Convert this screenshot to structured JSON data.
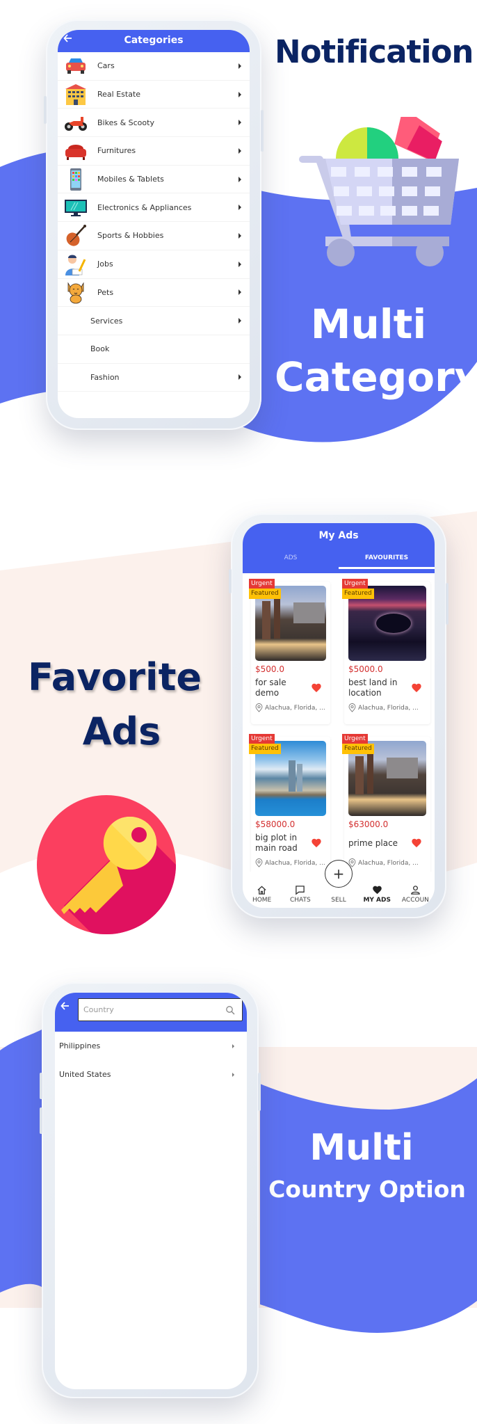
{
  "colors": {
    "brand_blue": "#4661f0",
    "wave_blue": "#5d72f2",
    "navy_text": "#0b2463",
    "peach_bg": "#fcf1ec",
    "price_red": "#d32f2f",
    "urgent_red": "#e53935",
    "featured_yellow": "#ffc107",
    "heart_red": "#f44336"
  },
  "section1": {
    "headline": "Notification",
    "feature_line1": "Multi",
    "feature_line2": "Category",
    "illustration": "shopping-cart-icon",
    "screen": {
      "title": "Categories",
      "back_icon": "arrow-left-icon",
      "categories": [
        {
          "label": "Cars",
          "icon": "car-icon",
          "has_children": true
        },
        {
          "label": "Real Estate",
          "icon": "building-icon",
          "has_children": true
        },
        {
          "label": "Bikes & Scooty",
          "icon": "motorcycle-icon",
          "has_children": true
        },
        {
          "label": "Furnitures",
          "icon": "sofa-icon",
          "has_children": true
        },
        {
          "label": "Mobiles & Tablets",
          "icon": "smartphone-icon",
          "has_children": true
        },
        {
          "label": "Electronics & Appliances",
          "icon": "tv-icon",
          "has_children": true
        },
        {
          "label": "Sports & Hobbies",
          "icon": "violin-icon",
          "has_children": true
        },
        {
          "label": "Jobs",
          "icon": "worker-icon",
          "has_children": true
        },
        {
          "label": "Pets",
          "icon": "cat-icon",
          "has_children": true
        },
        {
          "label": "Services",
          "icon": null,
          "has_children": true
        },
        {
          "label": "Book",
          "icon": null,
          "has_children": false
        },
        {
          "label": "Fashion",
          "icon": null,
          "has_children": true
        }
      ]
    }
  },
  "section2": {
    "feature_line1": "Favorite",
    "feature_line2": "Ads",
    "illustration": "key-icon",
    "screen": {
      "title": "My Ads",
      "tabs": [
        {
          "label": "ADS",
          "active": false
        },
        {
          "label": "FAVOURITES",
          "active": true
        }
      ],
      "ads": [
        {
          "price": "$500.0",
          "title": "for sale demo",
          "location": "Alachua, Florida, ...",
          "badges": [
            "Urgent",
            "Featured"
          ],
          "favorited": true,
          "image": "city-dusk-photo"
        },
        {
          "price": "$5000.0",
          "title": "best land in location",
          "location": "Alachua, Florida, ...",
          "badges": [
            "Urgent",
            "Featured"
          ],
          "favorited": true,
          "image": "night-bay-photo"
        },
        {
          "price": "$58000.0",
          "title": "big plot in main road",
          "location": "Alachua, Florida, ...",
          "badges": [
            "Urgent",
            "Featured"
          ],
          "favorited": true,
          "image": "coastal-city-photo"
        },
        {
          "price": "$63000.0",
          "title": "prime place",
          "location": "Alachua, Florida, ...",
          "badges": [
            "Urgent",
            "Featured"
          ],
          "favorited": true,
          "image": "city-dusk-photo"
        }
      ],
      "bottom_nav": [
        {
          "label": "HOME",
          "icon": "home-icon",
          "active": false
        },
        {
          "label": "CHATS",
          "icon": "chat-icon",
          "active": false
        },
        {
          "label": "SELL",
          "icon": "plus-icon",
          "active": false
        },
        {
          "label": "MY ADS",
          "icon": "heart-icon",
          "active": true
        },
        {
          "label": "ACCOUN",
          "icon": "account-icon",
          "active": false
        }
      ]
    }
  },
  "section3": {
    "feature_line1": "Multi",
    "feature_line2": "Country Option",
    "screen": {
      "search_placeholder": "Country",
      "search_value": "",
      "countries": [
        {
          "label": "Philippines"
        },
        {
          "label": "United States"
        }
      ]
    }
  }
}
